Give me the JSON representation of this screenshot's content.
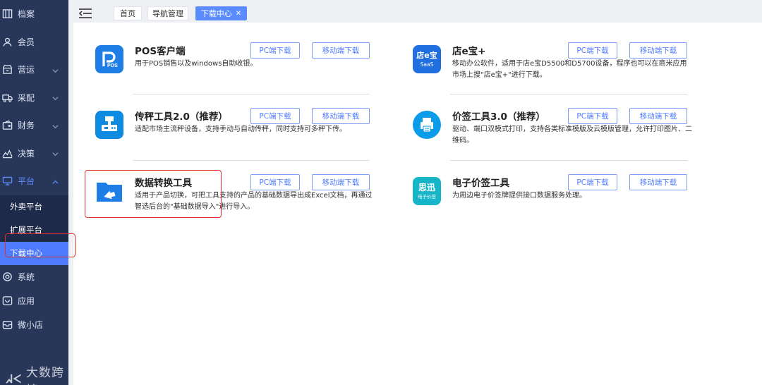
{
  "sidebar": {
    "items": [
      {
        "label": "档案",
        "icon": "archive-icon"
      },
      {
        "label": "会员",
        "icon": "user-icon"
      },
      {
        "label": "营运",
        "icon": "store-icon"
      },
      {
        "label": "采配",
        "icon": "truck-icon"
      },
      {
        "label": "财务",
        "icon": "wallet-icon"
      },
      {
        "label": "决策",
        "icon": "chart-icon"
      },
      {
        "label": "平台",
        "icon": "monitor-icon"
      }
    ],
    "subitems": [
      {
        "label": "外卖平台"
      },
      {
        "label": "扩展平台"
      },
      {
        "label": "下载中心"
      }
    ],
    "lower": [
      {
        "label": "系统",
        "icon": "gear-icon"
      },
      {
        "label": "应用",
        "icon": "app-icon"
      },
      {
        "label": "微小店",
        "icon": "shop-icon"
      }
    ]
  },
  "topbar": {
    "tabs": [
      {
        "label": "首页"
      },
      {
        "label": "导航管理"
      },
      {
        "label": "下载中心"
      }
    ],
    "close_glyph": "✕"
  },
  "downloads": [
    {
      "title": "POS客户端",
      "desc": "用于POS销售以及windows自助收银。",
      "pc": "PC端下载",
      "mobile": "移动端下载",
      "icon": "pos-icon",
      "color": "#1f7de6"
    },
    {
      "title": "店e宝+",
      "desc": "移动办公软件，适用于店e宝D5500和D5700设备，程序也可以在商米应用市场上搜\"店e宝+\"进行下载。",
      "pc": "PC端下载",
      "mobile": "移动端下载",
      "icon": "dianebao-icon",
      "color": "#1f6fe0",
      "icon_text": "店e宝",
      "icon_sub": "SaaS"
    },
    {
      "title": "传秤工具2.0（推荐）",
      "desc": "适配市场主流秤设备，支持手动与自动传秤，同时支持可多秤下传。",
      "pc": "PC端下载",
      "mobile": "移动端下载",
      "icon": "scale-icon",
      "color": "#0d8be0"
    },
    {
      "title": "价签工具3.0（推荐）",
      "desc": "驱动、端口双模式打印，支持各类标准模版及云模版管理，允许打印图片、二维码。",
      "pc": "PC端下载",
      "mobile": "移动端下载",
      "icon": "printer-icon",
      "color": "#0a9ce8"
    },
    {
      "title": "数据转换工具",
      "desc": "适用于产品切换，可把工具支持的产品的基础数据导出成Excel文档，再通过智选后台的\"基础数据导入\"进行导入。",
      "pc": "PC端下载",
      "mobile": "移动端下载",
      "icon": "folder-icon",
      "color": "#1f7de6"
    },
    {
      "title": "电子价签工具",
      "desc": "为周边电子价签牌提供接口数据服务处理。",
      "pc": "PC端下载",
      "mobile": "移动端下载",
      "icon": "sixun-icon",
      "color": "#16b5c7",
      "icon_text": "思迅",
      "icon_sub": "电子价签"
    }
  ],
  "watermark": {
    "logo": "ᖽᐸ",
    "text": "大数跨境"
  }
}
